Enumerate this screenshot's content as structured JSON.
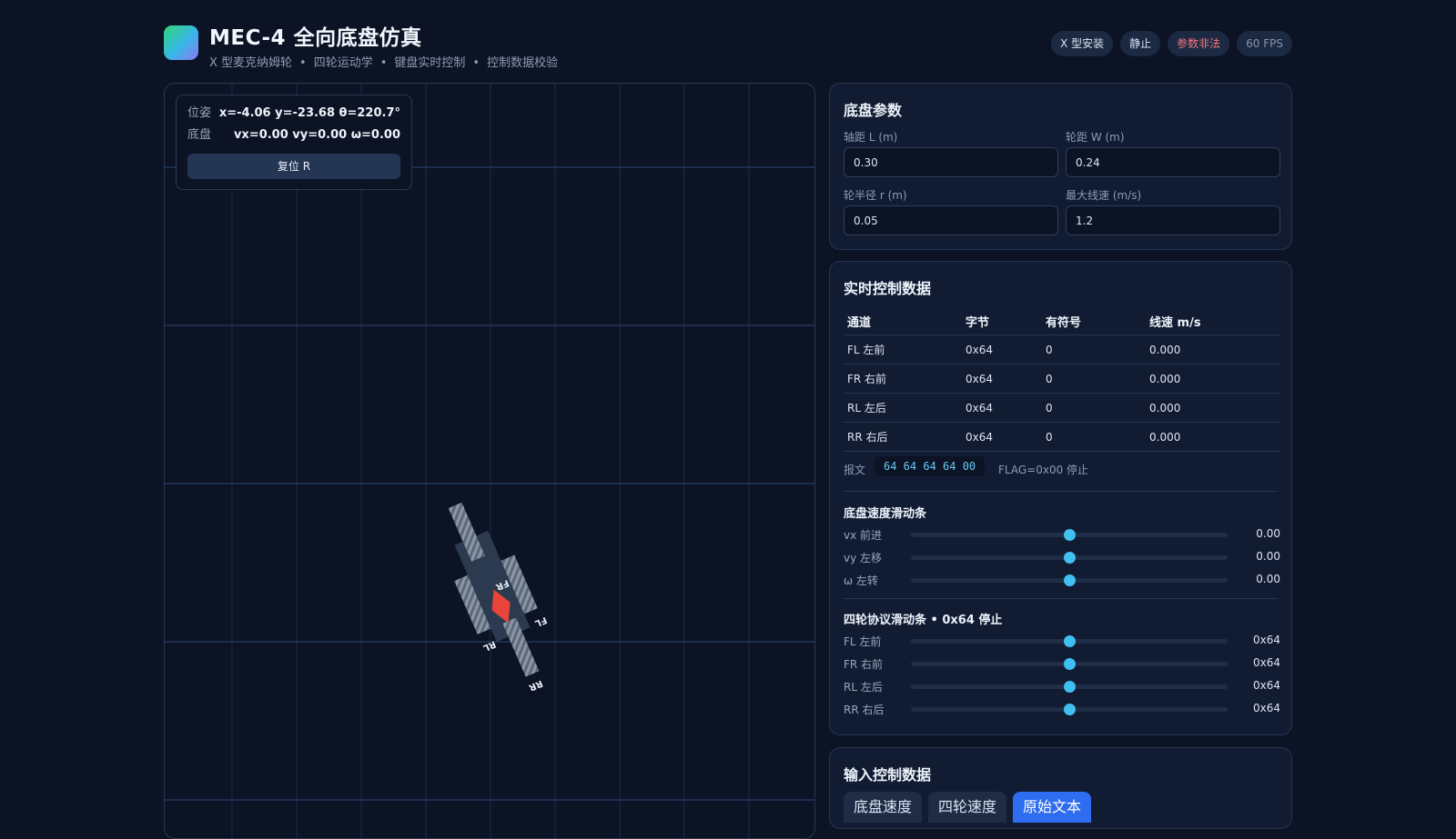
{
  "header": {
    "title": "MEC-4 全向底盘仿真",
    "subtitle": [
      "X 型麦克纳姆轮",
      "四轮运动学",
      "键盘实时控制",
      "控制数据校验"
    ],
    "badges": {
      "mount": "X 型安装",
      "state": "静止",
      "param_status": "参数非法",
      "fps": "60 FPS"
    }
  },
  "sim": {
    "pose_label": "位姿",
    "pose_value": "x=-4.06 y=-23.68 θ=220.7°",
    "chassis_label": "底盘",
    "chassis_value": "vx=0.00 vy=0.00 ω=0.00",
    "reset_label": "复位 R",
    "wheel_labels": {
      "fl": "FL",
      "fr": "FR",
      "rl": "RL",
      "rr": "RR"
    }
  },
  "params": {
    "title": "底盘参数",
    "wheelbase": {
      "label": "轴距 L (m)",
      "value": "0.30"
    },
    "track": {
      "label": "轮距 W (m)",
      "value": "0.24"
    },
    "radius": {
      "label": "轮半径 r (m)",
      "value": "0.05"
    },
    "max_speed": {
      "label": "最大线速 (m/s)",
      "value": "1.2"
    }
  },
  "control": {
    "title": "实时控制数据",
    "headers": [
      "通道",
      "字节",
      "有符号",
      "线速 m/s"
    ],
    "rows": [
      [
        "FL 左前",
        "0x64",
        "0",
        "0.000"
      ],
      [
        "FR 右前",
        "0x64",
        "0",
        "0.000"
      ],
      [
        "RL 左后",
        "0x64",
        "0",
        "0.000"
      ],
      [
        "RR 右后",
        "0x64",
        "0",
        "0.000"
      ]
    ],
    "packet_label": "报文",
    "packet_hex": "64 64 64 64 00",
    "packet_flag": "FLAG=0x00 停止",
    "chassis_sliders": {
      "title": "底盘速度滑动条",
      "items": [
        {
          "label": "vx 前进",
          "value": "0.00",
          "fraction": 0.5
        },
        {
          "label": "vy 左移",
          "value": "0.00",
          "fraction": 0.5
        },
        {
          "label": "ω 左转",
          "value": "0.00",
          "fraction": 0.5
        }
      ]
    },
    "wheel_sliders": {
      "title": "四轮协议滑动条 • 0x64 停止",
      "items": [
        {
          "label": "FL 左前",
          "value": "0x64",
          "fraction": 0.5
        },
        {
          "label": "FR 右前",
          "value": "0x64",
          "fraction": 0.5
        },
        {
          "label": "RL 左后",
          "value": "0x64",
          "fraction": 0.5
        },
        {
          "label": "RR 右后",
          "value": "0x64",
          "fraction": 0.5
        }
      ]
    }
  },
  "input": {
    "title": "输入控制数据",
    "tabs": [
      {
        "label": "底盘速度",
        "active": false
      },
      {
        "label": "四轮速度",
        "active": false
      },
      {
        "label": "原始文本",
        "active": true
      }
    ]
  },
  "colors": {
    "accent": "#3fc0f0",
    "error": "#f37a80",
    "robot_marker": "#e8443a",
    "active_tab": "#2e6cf0"
  }
}
